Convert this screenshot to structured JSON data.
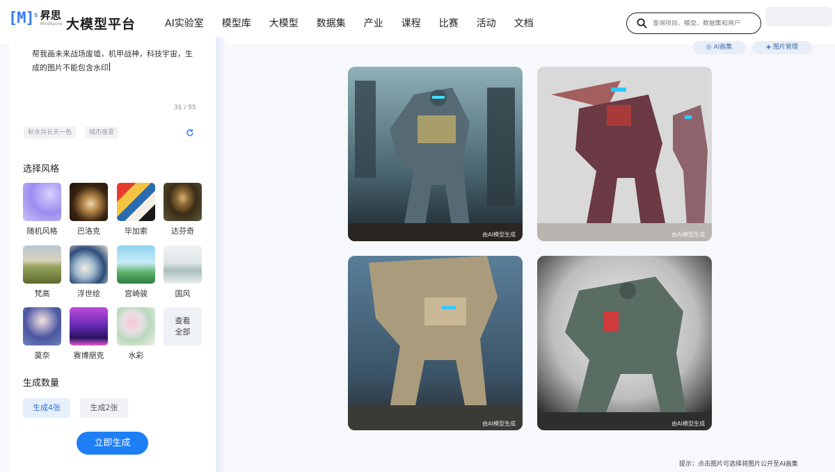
{
  "header": {
    "logo_cn": "昇思",
    "logo_en": "MindSpore",
    "brand": "大模型平台",
    "nav": [
      "AI实验室",
      "模型库",
      "大模型",
      "数据集",
      "产业",
      "课程",
      "比赛",
      "活动",
      "文档"
    ],
    "search_placeholder": "查询项目、模型、数据集和用户"
  },
  "prompt": {
    "text": "帮我画未来战场废墟，机甲战神，科技宇宙，生成的图片不能包含水印",
    "counter": "31 / 55",
    "suggestions": [
      "秋水共长天一色",
      "城市夜景"
    ]
  },
  "styles": {
    "title": "选择风格",
    "items": [
      {
        "label": "随机风格",
        "icon": "random-style-thumb"
      },
      {
        "label": "巴洛克",
        "icon": "baroque-thumb"
      },
      {
        "label": "毕加索",
        "icon": "picasso-thumb"
      },
      {
        "label": "达芬奇",
        "icon": "davinci-thumb"
      },
      {
        "label": "梵高",
        "icon": "vangogh-thumb"
      },
      {
        "label": "浮世绘",
        "icon": "ukiyoe-thumb"
      },
      {
        "label": "宫崎骏",
        "icon": "miyazaki-thumb"
      },
      {
        "label": "国风",
        "icon": "chinese-style-thumb"
      },
      {
        "label": "莫奈",
        "icon": "monet-thumb"
      },
      {
        "label": "赛博朋克",
        "icon": "cyberpunk-thumb"
      },
      {
        "label": "水彩",
        "icon": "watercolor-thumb"
      }
    ],
    "view_all": "查看全部"
  },
  "count": {
    "title": "生成数量",
    "options": [
      "生成4张",
      "生成2张"
    ],
    "selected": "生成4张"
  },
  "generate_label": "立即生成",
  "toolbar": {
    "gallery": "AI画集",
    "manage": "图片管理"
  },
  "results": {
    "watermark": "由AI模型生成",
    "images": [
      "mech-robot-ruins-1",
      "mech-robot-red-2",
      "mech-robot-tan-3",
      "mech-robot-green-4"
    ]
  },
  "hint": "提示：点击图片可选择将图片公开至AI画集",
  "colors": {
    "accent": "#1e7ef5",
    "accent_light": "#e6effc"
  }
}
